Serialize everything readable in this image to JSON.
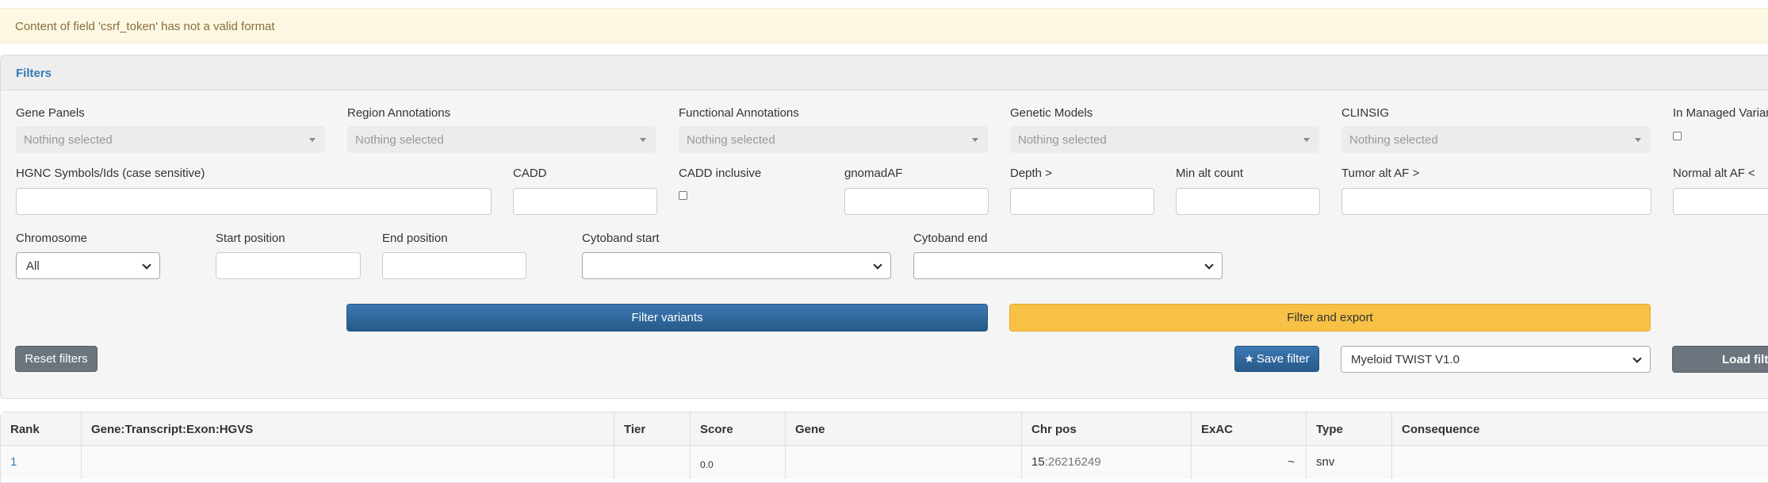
{
  "alert": {
    "message": "Content of field 'csrf_token' has not a valid format"
  },
  "filters": {
    "title": "Filters",
    "gene_panels": {
      "label": "Gene Panels",
      "value": "Nothing selected"
    },
    "region_annotations": {
      "label": "Region Annotations",
      "value": "Nothing selected"
    },
    "functional_annotations": {
      "label": "Functional Annotations",
      "value": "Nothing selected"
    },
    "genetic_models": {
      "label": "Genetic Models",
      "value": "Nothing selected"
    },
    "clinsig": {
      "label": "CLINSIG",
      "value": "Nothing selected"
    },
    "in_managed_variants": {
      "label": "In Managed Varian"
    },
    "hgnc_symbols": {
      "label": "HGNC Symbols/Ids (case sensitive)"
    },
    "cadd": {
      "label": "CADD"
    },
    "cadd_inclusive": {
      "label": "CADD inclusive"
    },
    "gnomad_af": {
      "label": "gnomadAF"
    },
    "depth": {
      "label": "Depth >"
    },
    "min_alt_count": {
      "label": "Min alt count"
    },
    "tumor_alt_af": {
      "label": "Tumor alt AF >"
    },
    "normal_alt_af": {
      "label": "Normal alt AF <"
    },
    "chromosome": {
      "label": "Chromosome",
      "value": "All"
    },
    "start_position": {
      "label": "Start position"
    },
    "end_position": {
      "label": "End position"
    },
    "cytoband_start": {
      "label": "Cytoband start"
    },
    "cytoband_end": {
      "label": "Cytoband end"
    },
    "buttons": {
      "filter_variants": "Filter variants",
      "filter_export": "Filter and export",
      "reset": "Reset filters",
      "save": "Save filter",
      "load": "Load filte"
    },
    "saved_filter": {
      "value": "Myeloid TWIST V1.0"
    }
  },
  "table": {
    "headers": [
      "Rank",
      "Gene:Transcript:Exon:HGVS",
      "Tier",
      "Score",
      "Gene",
      "Chr pos",
      "ExAC",
      "Type",
      "Consequence"
    ],
    "rows": [
      {
        "rank": "1",
        "hgvs": "",
        "tier": "",
        "score": "0.0",
        "gene": "",
        "chr": "15",
        "pos": ":26216249",
        "exac": "~",
        "type": "snv",
        "consequence": ""
      }
    ]
  },
  "colors": {
    "primary": "#337ab7",
    "warning": "#f6c145",
    "alert_bg": "#fcf8e3",
    "secondary": "#6c757d"
  },
  "icons": {
    "save": "star-icon",
    "select": "chevron-down-icon",
    "multiselect": "caret-down-icon"
  }
}
